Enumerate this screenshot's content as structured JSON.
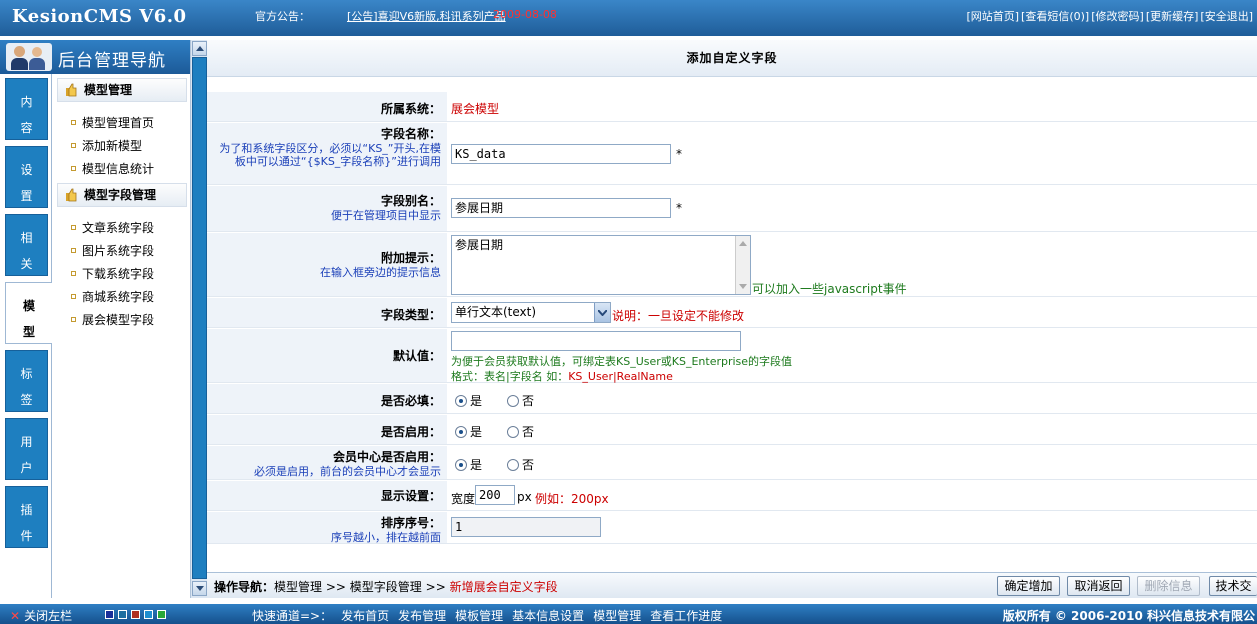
{
  "app": {
    "logo": "KesionCMS V6.0",
    "notice_label": "官方公告：",
    "notice_link": "[公告]喜迎V6新版,科讯系列产品",
    "notice_date": "2009-08-08",
    "top_links": [
      "[网站首页]",
      "[查看短信(0)]",
      "[修改密码]",
      "[更新缓存]",
      "[安全退出]"
    ]
  },
  "nav": {
    "title": "后台管理导航",
    "tabs": [
      {
        "label": "内容"
      },
      {
        "label": "设置"
      },
      {
        "label": "相关"
      },
      {
        "label": "模型",
        "active": true
      },
      {
        "label": "标签"
      },
      {
        "label": "用户"
      },
      {
        "label": "插件"
      }
    ],
    "groups": [
      {
        "title": "模型管理",
        "items": [
          "模型管理首页",
          "添加新模型",
          "模型信息统计"
        ]
      },
      {
        "title": "模型字段管理",
        "items": [
          "文章系统字段",
          "图片系统字段",
          "下载系统字段",
          "商城系统字段",
          "展会模型字段"
        ]
      }
    ]
  },
  "main": {
    "title": "添加自定义字段",
    "fields": {
      "system": {
        "label": "所属系统：",
        "value": "展会模型"
      },
      "name": {
        "label": "字段名称：",
        "hint": "为了和系统字段区分，必须以“KS_”开头,在模板中可以通过“{$KS_字段名称}”进行调用",
        "value": "KS_data",
        "required": "*"
      },
      "alias": {
        "label": "字段别名：",
        "hint": "便于在管理项目中显示",
        "value": "参展日期",
        "required": "*"
      },
      "tip": {
        "label": "附加提示：",
        "hint": "在输入框旁边的提示信息",
        "value": "参展日期",
        "note": "可以加入一些javascript事件"
      },
      "type": {
        "label": "字段类型：",
        "value": "单行文本(text)",
        "note_label": "说明：",
        "note": "一旦设定不能修改"
      },
      "default": {
        "label": "默认值：",
        "value": "",
        "hint1": "为便于会员获取默认值，可绑定表KS_User或KS_Enterprise的字段值",
        "hint2_label": "格式：表名|字段名 如：",
        "hint2_example": "KS_User|RealName"
      },
      "required": {
        "label": "是否必填：",
        "yes": "是",
        "no": "否",
        "selected": "yes"
      },
      "enabled": {
        "label": "是否启用：",
        "yes": "是",
        "no": "否",
        "selected": "yes"
      },
      "member": {
        "label": "会员中心是否启用：",
        "hint": "必须是启用，前台的会员中心才会显示",
        "yes": "是",
        "no": "否",
        "selected": "yes"
      },
      "display": {
        "label": "显示设置：",
        "width_label": "宽度",
        "width_value": "200",
        "unit": "px",
        "example": "例如：200px"
      },
      "order": {
        "label": "排序序号：",
        "hint": "序号越小，排在越前面",
        "value": "1"
      }
    }
  },
  "opbar": {
    "crumb_label": "操作导航：",
    "crumb1": "模型管理",
    "sep": ">>",
    "crumb2": "模型字段管理",
    "crumb3": "新增展会自定义字段",
    "buttons": {
      "confirm": "确定增加",
      "cancel": "取消返回",
      "delete": "删除信息",
      "tech": "技术交"
    }
  },
  "statusbar": {
    "close_left": "关闭左栏",
    "quick_label": "快速通道=>：",
    "quick_links": [
      "发布首页",
      "发布管理",
      "模板管理",
      "基本信息设置",
      "模型管理",
      "查看工作进度"
    ],
    "copyright": "版权所有 © 2006-2010 科兴信息技术有限公",
    "swatches": [
      "#1a2f9a",
      "#1e6fa0",
      "#b03020",
      "#1f8fd0",
      "#28a838"
    ]
  }
}
